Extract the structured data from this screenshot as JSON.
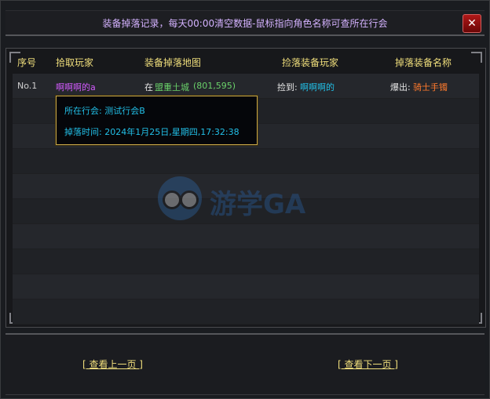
{
  "title": "装备掉落记录，每天00:00清空数据-鼠标指向角色名称可查所在行会",
  "close_label": "✕",
  "columns": [
    "序号",
    "拾取玩家",
    "装备掉落地图",
    "捡落装备玩家",
    "掉落装备名称"
  ],
  "rows": [
    {
      "no": "No.1",
      "picker": "啊啊啊的a",
      "map_prefix": "在",
      "map_name": "盟重土城",
      "map_coords": "(801,595)",
      "pick_prefix": "捡到:",
      "pick_player": "啊啊啊的",
      "drop_prefix": "爆出:",
      "item_name": "骑士手镯"
    }
  ],
  "tooltip": {
    "guild_label": "所在行会:",
    "guild_value": "测试行会B",
    "time_label": "掉落时间:",
    "time_value": "2024年1月25日,星期四,17:32:38"
  },
  "watermark": {
    "text": "游学GA"
  },
  "footer": {
    "prev_label": "[ 查看上一页 ]",
    "next_label": "[ 查看下一页 ]"
  },
  "colors": {
    "header": "#f1df7c",
    "picker": "#d45bff",
    "map_name": "#6ad26a",
    "pick_player": "#22c0e8",
    "item_name": "#ff7a2c",
    "tooltip_text": "#22c0e8"
  }
}
